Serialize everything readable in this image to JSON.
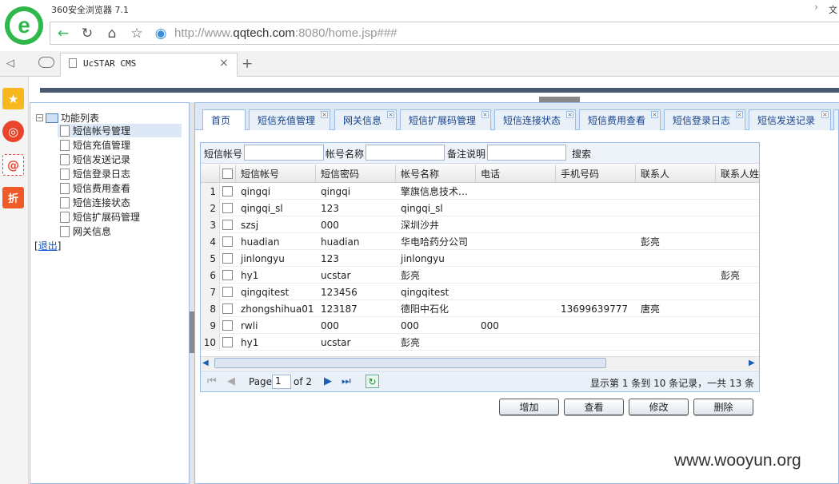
{
  "browser": {
    "title": "360安全浏览器 7.1",
    "url_prefix": "http://www.",
    "url_domain": "qqtech.com",
    "url_suffix": ":8080/home.jsp###",
    "tab_title": "UcSTAR CMS",
    "tab_close": "×",
    "new_tab": "+",
    "top_right": "文"
  },
  "sidebar": {
    "root": "功能列表",
    "items": [
      "短信帐号管理",
      "短信充值管理",
      "短信发送记录",
      "短信登录日志",
      "短信费用查看",
      "短信连接状态",
      "短信扩展码管理",
      "网关信息"
    ],
    "logout_open": "[",
    "logout": "退出",
    "logout_close": "]"
  },
  "tabs": [
    "首页",
    "短信充值管理",
    "网关信息",
    "短信扩展码管理",
    "短信连接状态",
    "短信费用查看",
    "短信登录日志",
    "短信发送记录"
  ],
  "search": {
    "label_account": "短信帐号",
    "label_name": "帐号名称",
    "label_note": "备注说明",
    "search_btn": "搜索"
  },
  "grid": {
    "columns": [
      "短信帐号",
      "短信密码",
      "帐号名称",
      "电话",
      "手机号码",
      "联系人",
      "联系人姓"
    ],
    "rows": [
      {
        "n": "1",
        "c": [
          "qingqi",
          "qingqi",
          "擎旗信息技术…",
          "",
          "",
          "",
          ""
        ]
      },
      {
        "n": "2",
        "c": [
          "qingqi_sl",
          "123",
          "qingqi_sl",
          "",
          "",
          "",
          ""
        ]
      },
      {
        "n": "3",
        "c": [
          "szsj",
          "000",
          "深圳沙井",
          "",
          "",
          "",
          ""
        ]
      },
      {
        "n": "4",
        "c": [
          "huadian",
          "huadian",
          "华电哈药分公司",
          "",
          "",
          "彭亮",
          ""
        ]
      },
      {
        "n": "5",
        "c": [
          "jinlongyu",
          "123",
          "jinlongyu",
          "",
          "",
          "",
          ""
        ]
      },
      {
        "n": "6",
        "c": [
          "hy1",
          "ucstar",
          "彭亮",
          "",
          "",
          "",
          "彭亮"
        ]
      },
      {
        "n": "7",
        "c": [
          "qingqitest",
          "123456",
          "qingqitest",
          "",
          "",
          "",
          ""
        ]
      },
      {
        "n": "8",
        "c": [
          "zhongshihua01",
          "123187",
          "德阳中石化",
          "",
          "13699639777",
          "唐亮",
          ""
        ]
      },
      {
        "n": "9",
        "c": [
          "rwli",
          "000",
          "000",
          "000",
          "",
          "",
          ""
        ]
      },
      {
        "n": "10",
        "c": [
          "hy1",
          "ucstar",
          "彭亮",
          "",
          "",
          "",
          ""
        ]
      }
    ]
  },
  "pager": {
    "page_label": "Page",
    "page_value": "1",
    "of_label": "of 2",
    "summary": "显示第 1 条到 10 条记录，一共 13 条"
  },
  "actions": {
    "add": "增加",
    "view": "查看",
    "edit": "修改",
    "delete": "删除"
  },
  "watermark": "www.wooyun.org"
}
